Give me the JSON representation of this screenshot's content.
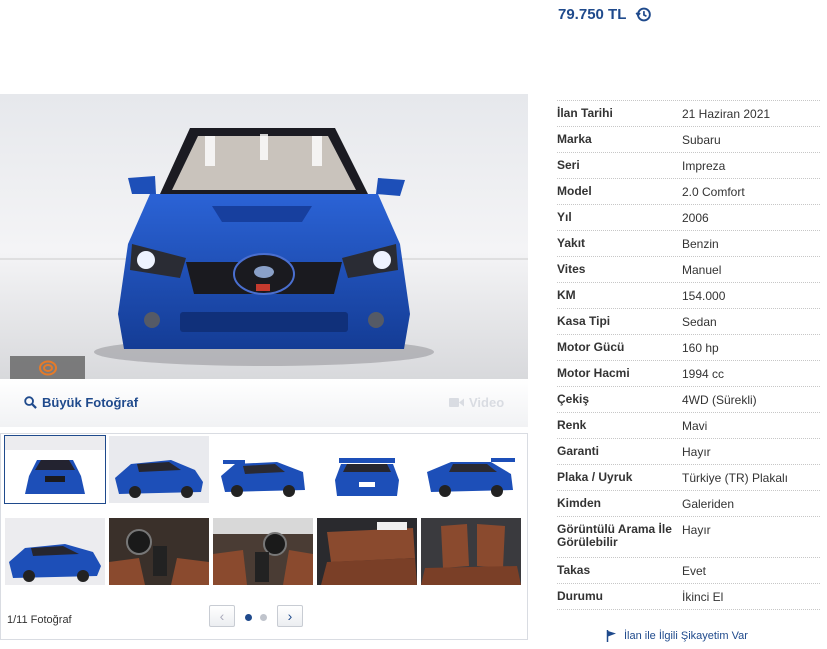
{
  "price": {
    "value": "79.750 TL",
    "icon": "history-icon"
  },
  "gallery": {
    "big_photo_label": "Büyük Fotoğraf",
    "video_label": "Video",
    "counter": "1/11 Fotoğraf",
    "thumbnails": [
      "front",
      "front-left",
      "rear-right",
      "rear",
      "rear-left",
      "side-left",
      "dashboard",
      "interior-front",
      "rear-seats",
      "front-seats"
    ]
  },
  "details": [
    {
      "key": "İlan Tarihi",
      "value": "21 Haziran 2021"
    },
    {
      "key": "Marka",
      "value": "Subaru"
    },
    {
      "key": "Seri",
      "value": "Impreza"
    },
    {
      "key": "Model",
      "value": "2.0 Comfort"
    },
    {
      "key": "Yıl",
      "value": "2006"
    },
    {
      "key": "Yakıt",
      "value": "Benzin"
    },
    {
      "key": "Vites",
      "value": "Manuel"
    },
    {
      "key": "KM",
      "value": "154.000"
    },
    {
      "key": "Kasa Tipi",
      "value": "Sedan"
    },
    {
      "key": "Motor Gücü",
      "value": "160 hp"
    },
    {
      "key": "Motor Hacmi",
      "value": "1994 cc"
    },
    {
      "key": "Çekiş",
      "value": "4WD (Sürekli)"
    },
    {
      "key": "Renk",
      "value": "Mavi"
    },
    {
      "key": "Garanti",
      "value": "Hayır"
    },
    {
      "key": "Plaka / Uyruk",
      "value": "Türkiye (TR) Plakalı"
    },
    {
      "key": "Kimden",
      "value": "Galeriden"
    },
    {
      "key": "Görüntülü Arama İle Görülebilir",
      "value": "Hayır"
    },
    {
      "key": "Takas",
      "value": "Evet"
    },
    {
      "key": "Durumu",
      "value": "İkinci El"
    }
  ],
  "complaint_label": "İlan ile İlgili Şikayetim Var",
  "colors": {
    "brand": "#1f4a8c",
    "car_blue": "#1d4fb8"
  }
}
